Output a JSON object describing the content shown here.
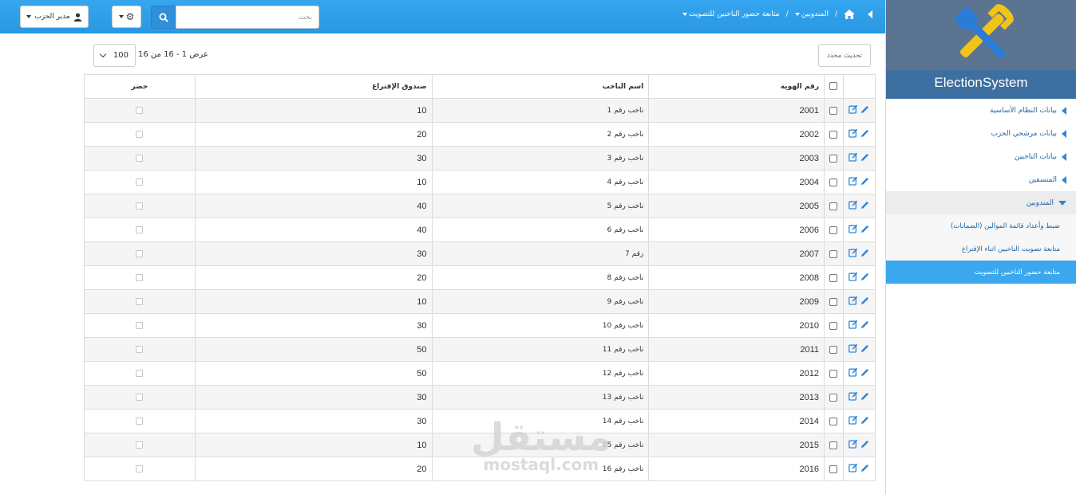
{
  "app": {
    "brand_title": "ElectionSystem"
  },
  "header": {
    "user_label": "مدير الحزب",
    "search_placeholder": "بحث",
    "breadcrumb": {
      "level1": "المندوبين",
      "level2": "متابعة حضور الناخبين للتصويت"
    }
  },
  "sidebar": {
    "items": [
      {
        "label": "بيانات النظام الأساسية"
      },
      {
        "label": "بيانات مرشحي الحزب"
      },
      {
        "label": "بيانات الناخبين"
      },
      {
        "label": "المنسقين"
      },
      {
        "label": "المندوبين"
      }
    ],
    "subitems": [
      {
        "label": "ضبط وأعداد قائمة الموالين (الضمانات)"
      },
      {
        "label": "متابعة تصويت الناخبين اثناء الإقتراع"
      },
      {
        "label": "متابعة حضور الناخبين للتصويت"
      }
    ]
  },
  "toolbar": {
    "refresh_label": "تحديث محدد",
    "page_size": "100",
    "page_info": "عرض 1 - 16 من 16"
  },
  "table": {
    "headers": {
      "id": "رقم الهوية",
      "name": "اسم الناخب",
      "box": "صندوق الإقتراع",
      "present": "حضر"
    },
    "rows": [
      {
        "id": "2001",
        "name": "ناخب رقم 1",
        "box": "10"
      },
      {
        "id": "2002",
        "name": "ناخب رقم 2",
        "box": "20"
      },
      {
        "id": "2003",
        "name": "ناخب رقم 3",
        "box": "30"
      },
      {
        "id": "2004",
        "name": "ناخب رقم 4",
        "box": "10"
      },
      {
        "id": "2005",
        "name": "ناخب رقم 5",
        "box": "40"
      },
      {
        "id": "2006",
        "name": "ناخب رقم 6",
        "box": "40"
      },
      {
        "id": "2007",
        "name": "رقم 7",
        "box": "30"
      },
      {
        "id": "2008",
        "name": "ناخب رقم 8",
        "box": "20"
      },
      {
        "id": "2009",
        "name": "ناخب رقم 9",
        "box": "10"
      },
      {
        "id": "2010",
        "name": "ناخب رقم 10",
        "box": "30"
      },
      {
        "id": "2011",
        "name": "ناخب رقم 11",
        "box": "50"
      },
      {
        "id": "2012",
        "name": "ناخب رقم 12",
        "box": "50"
      },
      {
        "id": "2013",
        "name": "ناخب رقم 13",
        "box": "30"
      },
      {
        "id": "2014",
        "name": "ناخب رقم 14",
        "box": "30"
      },
      {
        "id": "2015",
        "name": "ناخب رقم 15",
        "box": "10"
      },
      {
        "id": "2016",
        "name": "ناخب رقم 16",
        "box": "20"
      }
    ]
  },
  "watermark": {
    "arabic": "مستقل",
    "latin": "mostaql.com"
  },
  "colors": {
    "topbar": "#2d9ee8",
    "sidebar_active": "#3aa7ee",
    "brand": "#5a7491",
    "link": "#1f62a3"
  }
}
